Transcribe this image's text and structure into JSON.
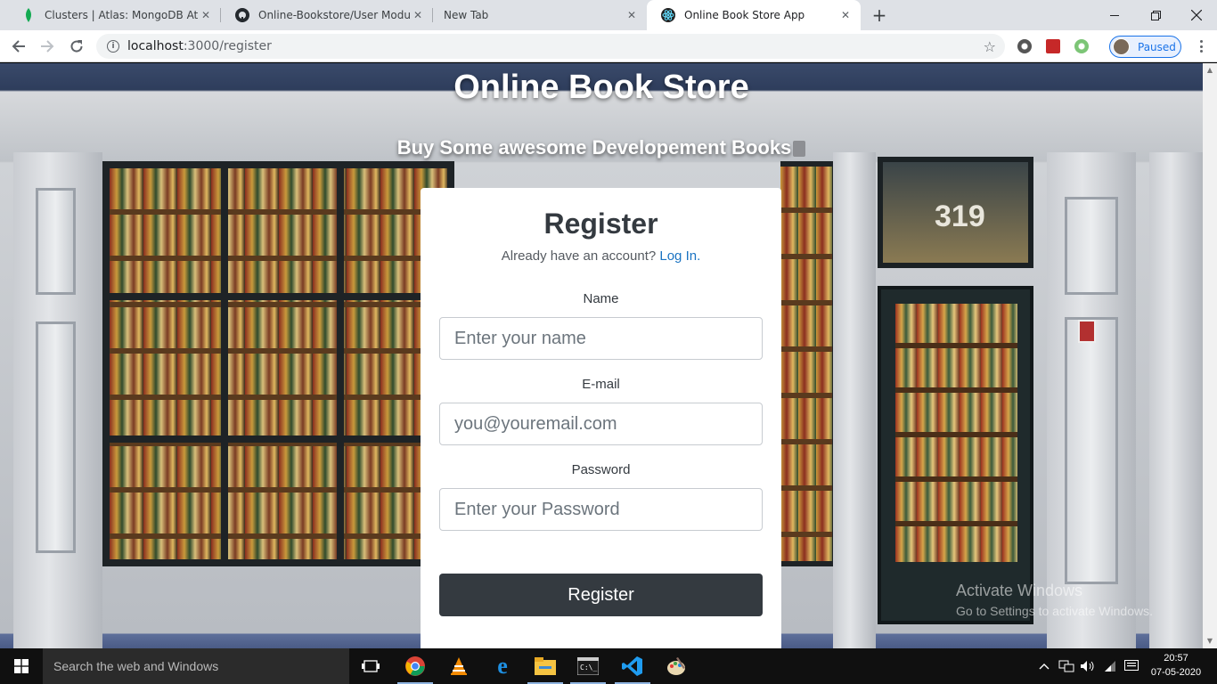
{
  "browser": {
    "tabs": [
      {
        "title": "Clusters | Atlas: MongoDB Atlas",
        "active": false
      },
      {
        "title": "Online-Bookstore/User Module/E",
        "active": false
      },
      {
        "title": "New Tab",
        "active": false
      },
      {
        "title": "Online Book Store App",
        "active": true
      }
    ],
    "url_host": "localhost",
    "url_path": ":3000/register",
    "profile_status": "Paused"
  },
  "page": {
    "title": "Online Book Store",
    "subtitle": "Buy Some awesome Developement Books",
    "card": {
      "heading": "Register",
      "login_prompt": "Already have an account?",
      "login_link": "Log In.",
      "fields": {
        "name": {
          "label": "Name",
          "placeholder": "Enter your name",
          "value": ""
        },
        "email": {
          "label": "E-mail",
          "placeholder": "you@youremail.com",
          "value": ""
        },
        "password": {
          "label": "Password",
          "placeholder": "Enter your Password",
          "value": ""
        }
      },
      "submit_label": "Register"
    },
    "storefront_number": "319"
  },
  "watermark": {
    "line1": "Activate Windows",
    "line2": "Go to Settings to activate Windows."
  },
  "taskbar": {
    "search_placeholder": "Search the web and Windows",
    "time": "20:57",
    "date": "07-05-2020"
  },
  "colors": {
    "card_bg": "#ffffff",
    "button_bg": "#343a40",
    "link": "#1a73c2",
    "title_text": "#ffffff"
  }
}
